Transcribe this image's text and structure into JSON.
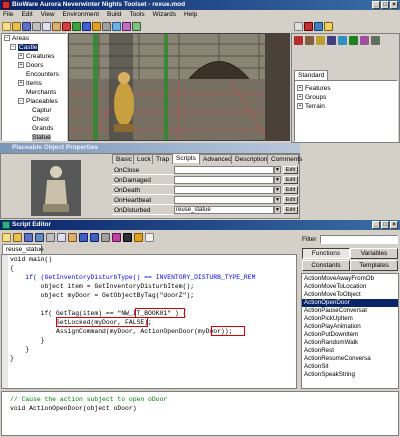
{
  "app": {
    "title": "BioWare Aurora Neverwinter Nights Toolset - rexue.mod",
    "menu": [
      "File",
      "Edit",
      "View",
      "Environment",
      "Build",
      "Tools",
      "Wizards",
      "Help"
    ]
  },
  "areas_tree": {
    "root": "Areas",
    "area": "Castle",
    "items": [
      "Creatures",
      "Doors",
      "Encounters",
      "Items",
      "Merchants",
      "Placeables"
    ],
    "placeables": [
      "Captur",
      "Chest",
      "Grands",
      "Statue"
    ]
  },
  "palette": {
    "tab": "Standard",
    "items": [
      "Features",
      "Groups",
      "Terrain"
    ]
  },
  "props": {
    "title": "Placeable Object Properties",
    "tabs": [
      "Basic",
      "Lock",
      "Trap",
      "Scripts",
      "Advanced",
      "Description",
      "Comments"
    ],
    "active_tab": "Scripts",
    "edit_label": "Edit",
    "events": [
      {
        "name": "OnClose",
        "value": ""
      },
      {
        "name": "OnDamaged",
        "value": ""
      },
      {
        "name": "OnDeath",
        "value": ""
      },
      {
        "name": "OnHeartbeat",
        "value": ""
      },
      {
        "name": "OnDisturbed",
        "value": "reuse_statue"
      }
    ]
  },
  "script_editor": {
    "title": "Script Editor",
    "file_tab": "reuse_statue",
    "filter_label": "Filter",
    "tabs_row1": [
      "Functions",
      "Variables"
    ],
    "tabs_row2": [
      "Constants",
      "Templates"
    ],
    "code": [
      "void main()",
      "{",
      "    if( (GetInventoryDisturbType() == INVENTORY_DISTURB_TYPE_REM",
      "        object item = GetInventoryDisturbItem();",
      "        object myDoor = GetObjectByTag(\"doorZ\");",
      "",
      "        if( GetTag(item) == \"NW_IT_BOOK01\" ) {",
      "            SetLocked(myDoor, FALSE);",
      "            AssignCommand(myDoor, ActionOpenDoor(myDoor));",
      "        }",
      "    }",
      "}"
    ],
    "functions": [
      "ActionMoveAwayFromOb",
      "ActionMoveToLocation",
      "ActionMoveToObject",
      "ActionOpenDoor",
      "ActionPauseConversat",
      "ActionPickUpItem",
      "ActionPlayAnimation",
      "ActionPutDownItem",
      "ActionRandomWalk",
      "ActionRest",
      "ActionResumeConversa",
      "ActionSit",
      "ActionSpeakString"
    ],
    "selected_function": "ActionOpenDoor",
    "help_text": [
      "// Cause the action subject to open oDoor",
      "void ActionOpenDoor(object oDoor)"
    ]
  },
  "colors": {
    "titlebar": "#0a246a",
    "keyword": "#0000ff",
    "string": "#800080",
    "highlight": "#dd0000"
  }
}
